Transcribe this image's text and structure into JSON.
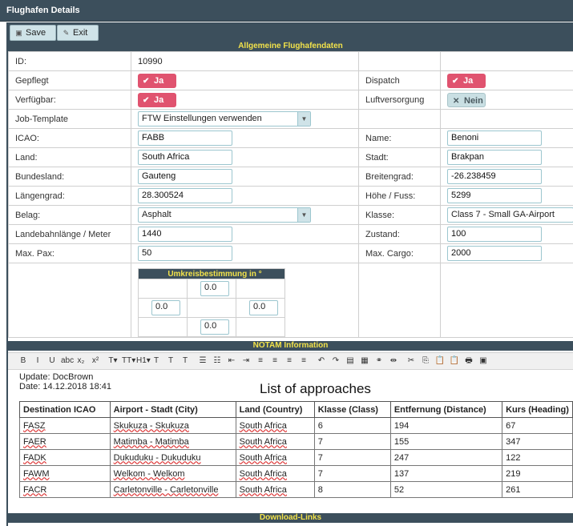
{
  "window": {
    "title": "Flughafen Details"
  },
  "toolbar": {
    "save_label": "Save",
    "exit_label": "Exit"
  },
  "section_general": "Allgemeine Flughafendaten",
  "fields": {
    "id_label": "ID:",
    "id_value": "10990",
    "gepflegt_label": "Gepflegt",
    "gepflegt_value": "Ja",
    "dispatch_label": "Dispatch",
    "dispatch_value": "Ja",
    "verfuegbar_label": "Verfügbar:",
    "verfuegbar_value": "Ja",
    "luftversorgung_label": "Luftversorgung",
    "luftversorgung_value": "Nein",
    "jobtemplate_label": "Job-Template",
    "jobtemplate_value": "FTW Einstellungen verwenden",
    "icao_label": "ICAO:",
    "icao_value": "FABB",
    "name_label": "Name:",
    "name_value": "Benoni",
    "land_label": "Land:",
    "land_value": "South Africa",
    "stadt_label": "Stadt:",
    "stadt_value": "Brakpan",
    "bundesland_label": "Bundesland:",
    "bundesland_value": "Gauteng",
    "breitengrad_label": "Breitengrad:",
    "breitengrad_value": "-26.238459",
    "laengengrad_label": "Längengrad:",
    "laengengrad_value": "28.300524",
    "hoehe_label": "Höhe / Fuss:",
    "hoehe_value": "5299",
    "belag_label": "Belag:",
    "belag_value": "Asphalt",
    "klasse_label": "Klasse:",
    "klasse_value": "Class 7 - Small GA-Airport",
    "landebahn_label": "Landebahnlänge / Meter",
    "landebahn_value": "1440",
    "zustand_label": "Zustand:",
    "zustand_value": "100",
    "maxpax_label": "Max. Pax:",
    "maxpax_value": "50",
    "maxcargo_label": "Max. Cargo:",
    "maxcargo_value": "2000"
  },
  "umkreis": {
    "title": "Umkreisbestimmung in °",
    "north": "0.0",
    "west": "0.0",
    "east": "0.0",
    "south": "0.0"
  },
  "section_notam": "NOTAM Information",
  "editor_toolbar": [
    "B",
    "I",
    "U",
    "abc",
    "x₂",
    "x²",
    "T▾",
    "TT▾",
    "H1▾",
    "T",
    "T",
    "T",
    "☰",
    "☷",
    "⇤",
    "⇥",
    "≡",
    "≡",
    "≡",
    "≡",
    "↶",
    "↷",
    "▤",
    "▦",
    "⚭",
    "⇹",
    "✂",
    "⎘",
    "📋",
    "📋",
    "🖶",
    "▣"
  ],
  "notam": {
    "update_line": "Update: DocBrown",
    "date_line": "Date: 14.12.2018 18:41",
    "list_title": "List of approaches",
    "headers": [
      "Destination ICAO",
      "Airport - Stadt (City)",
      "Land (Country)",
      "Klasse (Class)",
      "Entfernung (Distance)",
      "Kurs (Heading)"
    ],
    "rows": [
      [
        "FASZ",
        "Skukuza - Skukuza",
        "South Africa",
        "6",
        "194",
        "67"
      ],
      [
        "FAER",
        "Matimba - Matimba",
        "South Africa",
        "7",
        "155",
        "347"
      ],
      [
        "FADK",
        "Dukuduku - Dukuduku",
        "South Africa",
        "7",
        "247",
        "122"
      ],
      [
        "FAWM",
        "Welkom - Welkom",
        "South Africa",
        "7",
        "137",
        "219"
      ],
      [
        "FACR",
        "Carletonville - Carletonville",
        "South Africa",
        "8",
        "52",
        "261"
      ]
    ]
  },
  "section_download": "Download-Links"
}
